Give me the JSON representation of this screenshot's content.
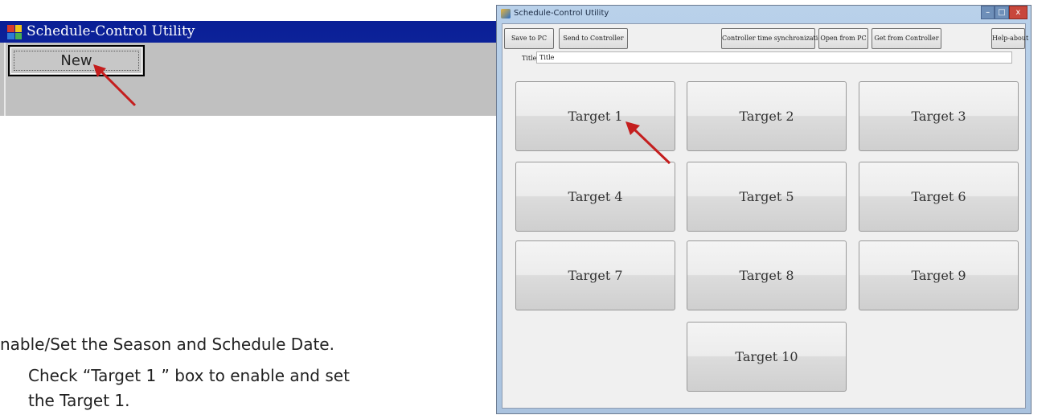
{
  "small_window": {
    "title": "Schedule-Control Utility",
    "new_button": "New"
  },
  "instructions": {
    "line1": "nable/Set the Season and Schedule Date.",
    "line2": "Check “Target 1 ” box to enable and set",
    "line3": "the Target 1."
  },
  "main_window": {
    "title": "Schedule-Control Utility",
    "toolbar": {
      "save_to_pc": "Save to PC",
      "send_to_controller": "Send to Controller",
      "time_sync": "Controller time synchronization",
      "open_from_pc": "Open from PC",
      "get_from_controller": "Get from Controller",
      "help_about": "Help-about"
    },
    "title_label": "Title",
    "title_value": "Title",
    "targets": [
      "Target 1",
      "Target 2",
      "Target 3",
      "Target 4",
      "Target 5",
      "Target 6",
      "Target 7",
      "Target 8",
      "Target 9",
      "Target 10"
    ]
  },
  "colors": {
    "arrow": "#c41e1e",
    "small_titlebar": "#0c2299",
    "small_body": "#c0c0c0"
  }
}
